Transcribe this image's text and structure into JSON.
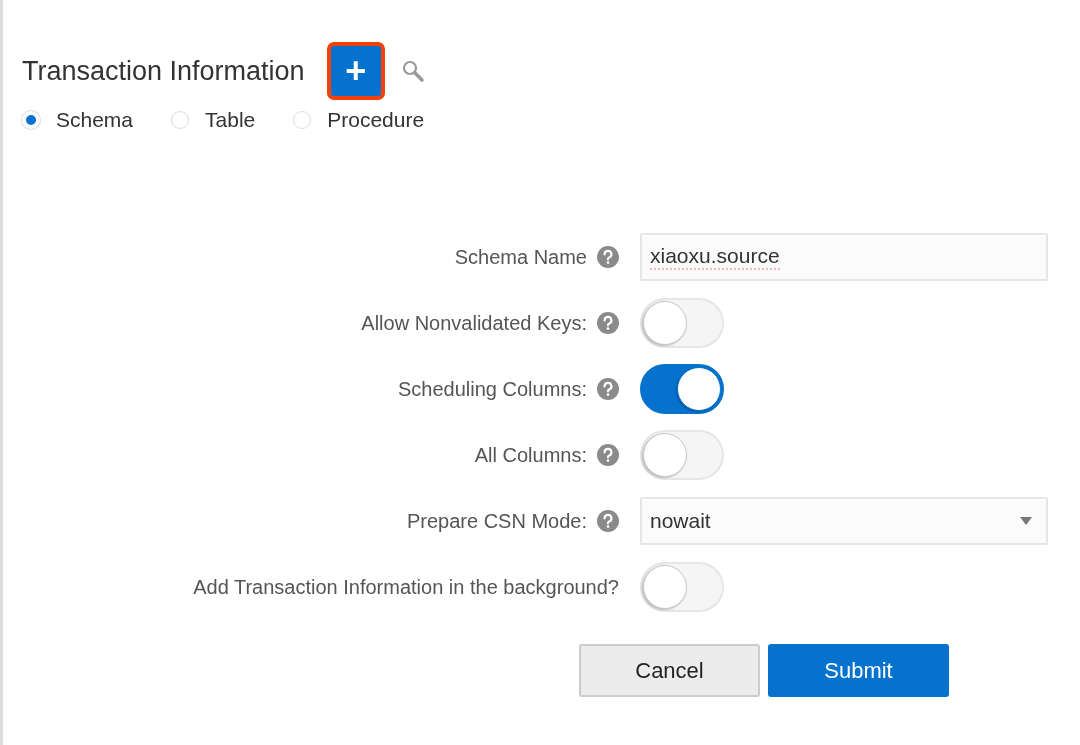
{
  "header": {
    "title": "Transaction Information",
    "add_button": {
      "label": "+",
      "highlighted": true
    }
  },
  "object_types": [
    {
      "label": "Schema",
      "selected": true
    },
    {
      "label": "Table",
      "selected": false
    },
    {
      "label": "Procedure",
      "selected": false
    }
  ],
  "fields": [
    {
      "kind": "text",
      "label": "Schema Name",
      "help": true,
      "value": "xiaoxu.source"
    },
    {
      "kind": "toggle",
      "label": "Allow Nonvalidated Keys:",
      "help": true,
      "on": false
    },
    {
      "kind": "toggle",
      "label": "Scheduling Columns:",
      "help": true,
      "on": true
    },
    {
      "kind": "toggle",
      "label": "All Columns:",
      "help": true,
      "on": false
    },
    {
      "kind": "select",
      "label": "Prepare CSN Mode:",
      "help": true,
      "value": "nowait"
    },
    {
      "kind": "toggle",
      "label": "Add Transaction Information in the background?",
      "help": false,
      "on": false
    }
  ],
  "buttons": [
    {
      "kind": "secondary",
      "label": "Cancel"
    },
    {
      "kind": "primary",
      "label": "Submit"
    }
  ]
}
